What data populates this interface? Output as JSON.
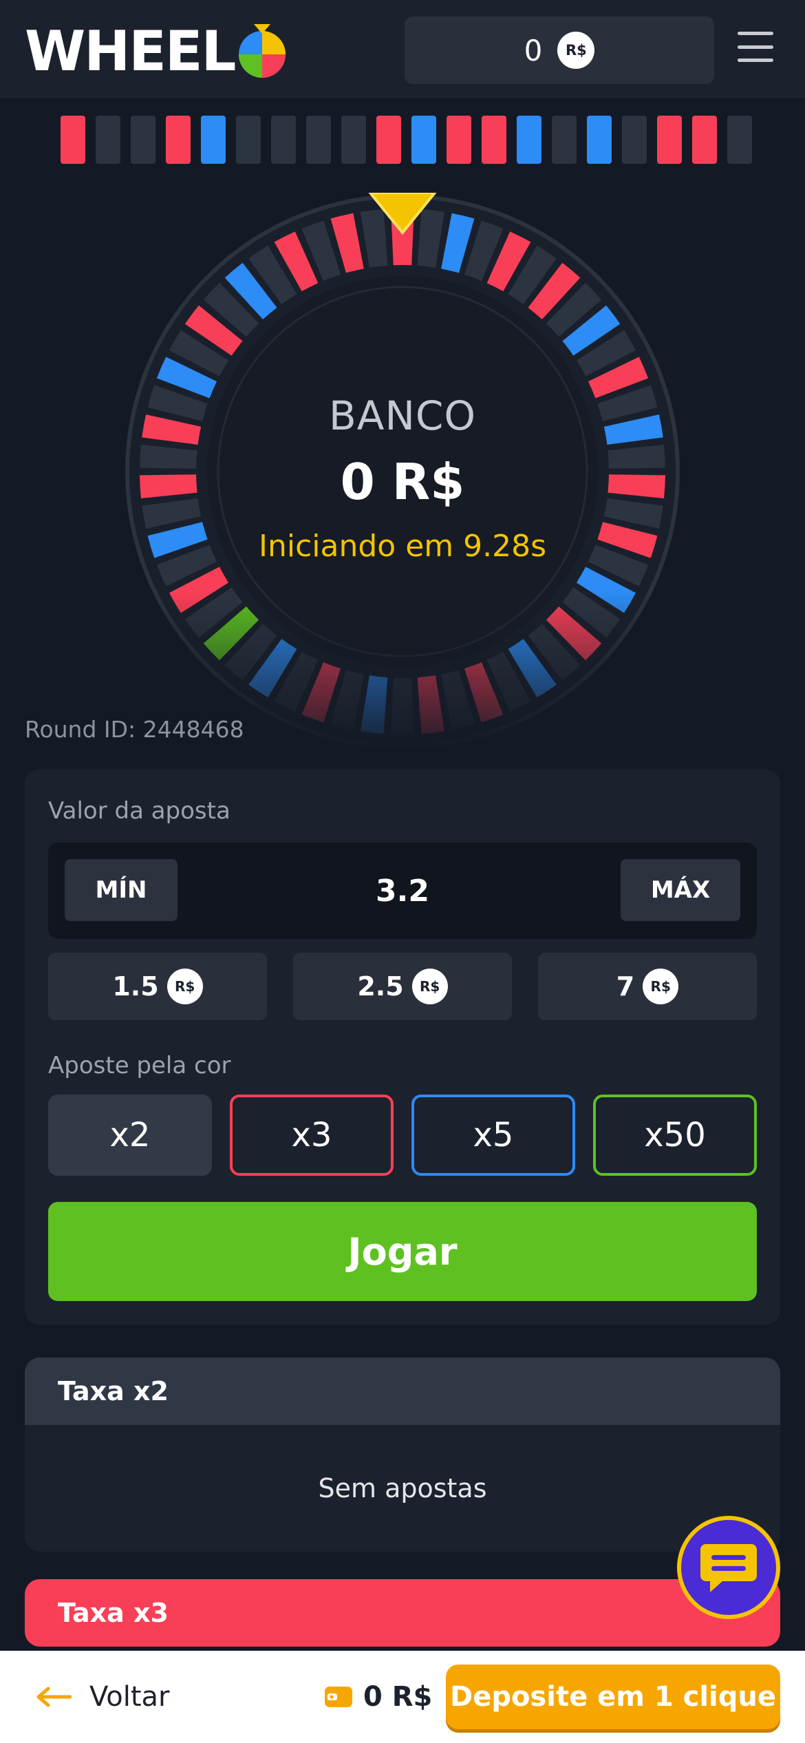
{
  "header": {
    "logo_text": "WHEEL",
    "balance": "0",
    "currency_badge": "R$"
  },
  "history": [
    "red",
    "grey",
    "grey",
    "red",
    "blue",
    "grey",
    "grey",
    "grey",
    "grey",
    "red",
    "blue",
    "red",
    "red",
    "blue",
    "grey",
    "blue",
    "grey",
    "red",
    "red",
    "grey"
  ],
  "wheel": {
    "label": "BANCO",
    "bank_value": "0 R$",
    "countdown": "Iniciando em 9.28s"
  },
  "round": {
    "label": "Round ID: 2448468"
  },
  "bet": {
    "amount_label": "Valor da aposta",
    "min_label": "MÍN",
    "max_label": "MÁX",
    "amount_value": "3.2",
    "quick_amounts": [
      "1.5",
      "2.5",
      "7"
    ],
    "currency_badge": "R$",
    "color_label": "Aposte pela cor",
    "multipliers": [
      "x2",
      "x3",
      "x5",
      "x50"
    ],
    "play_label": "Jogar"
  },
  "rates": [
    {
      "title": "Taxa x2",
      "empty_text": "Sem apostas"
    },
    {
      "title": "Taxa x3"
    }
  ],
  "bottom": {
    "back_label": "Voltar",
    "wallet_value": "0 R$",
    "deposit_label": "Deposite em 1 clique"
  },
  "colors": {
    "red": "#f93f57",
    "blue": "#2d8cf5",
    "grey": "#2c3441",
    "green": "#5ec121",
    "accent_yellow": "#f5c400",
    "deposit_orange": "#f7a600"
  }
}
